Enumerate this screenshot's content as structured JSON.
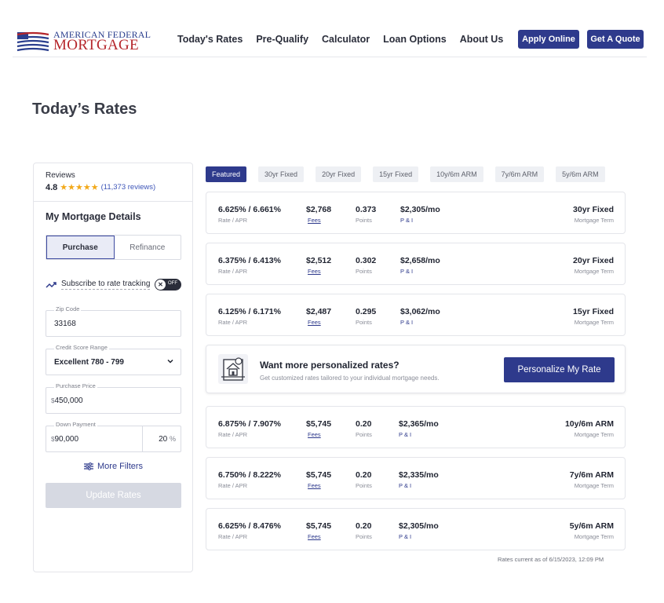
{
  "brand": {
    "name_top": "AMERICAN FEDERAL",
    "name_bottom": "MORTGAGE",
    "primary": "#2e3a8c",
    "accent": "#b5262b"
  },
  "nav": {
    "items": [
      "Today's Rates",
      "Pre-Qualify",
      "Calculator",
      "Loan Options",
      "About Us"
    ]
  },
  "header": {
    "apply_label": "Apply Online",
    "quote_label": "Get A Quote"
  },
  "page": {
    "title": "Today’s Rates"
  },
  "sidebar": {
    "reviews_label": "Reviews",
    "rating": "4.8",
    "stars": "★★★★★",
    "review_count": "(11,373 reviews)",
    "details_title": "My Mortgage Details",
    "purchase_label": "Purchase",
    "refinance_label": "Refinance",
    "track_label": "Subscribe to rate tracking",
    "toggle_label": "OFF",
    "zip": {
      "label": "Zip Code",
      "value": "33168"
    },
    "credit": {
      "label": "Credit Score Range",
      "value": "Excellent 780 - 799"
    },
    "price": {
      "label": "Purchase Price",
      "currency": "$",
      "value": "450,000"
    },
    "down": {
      "label": "Down Payment",
      "currency": "$",
      "value": "90,000",
      "percent": "20",
      "percent_sign": "%"
    },
    "more_filters": "More Filters",
    "update_label": "Update Rates"
  },
  "tabs": [
    "Featured",
    "30yr Fixed",
    "20yr Fixed",
    "15yr Fixed",
    "10y/6m ARM",
    "7y/6m ARM",
    "5y/6m ARM"
  ],
  "labels": {
    "rate_apr": "Rate / APR",
    "fees": "Fees",
    "points": "Points",
    "pi": "P & I",
    "term": "Mortgage Term"
  },
  "rates": [
    {
      "rate": "6.625% / 6.661%",
      "fees": "$2,768",
      "points": "0.373",
      "pi": "$2,305/mo",
      "term": "30yr Fixed"
    },
    {
      "rate": "6.375% / 6.413%",
      "fees": "$2,512",
      "points": "0.302",
      "pi": "$2,658/mo",
      "term": "20yr Fixed"
    },
    {
      "rate": "6.125% / 6.171%",
      "fees": "$2,487",
      "points": "0.295",
      "pi": "$3,062/mo",
      "term": "15yr Fixed"
    },
    {
      "rate": "6.875% / 7.907%",
      "fees": "$5,745",
      "points": "0.20",
      "pi": "$2,365/mo",
      "term": "10y/6m ARM"
    },
    {
      "rate": "6.750% / 8.222%",
      "fees": "$5,745",
      "points": "0.20",
      "pi": "$2,335/mo",
      "term": "7y/6m ARM"
    },
    {
      "rate": "6.625% / 8.476%",
      "fees": "$5,745",
      "points": "0.20",
      "pi": "$2,305/mo",
      "term": "5y/6m ARM"
    }
  ],
  "promo": {
    "title": "Want more personalized rates?",
    "subtitle": "Get customized rates tailored to your individual mortgage needs.",
    "button": "Personalize My Rate"
  },
  "footnote": "Rates current as of 6/15/2023, 12:09 PM"
}
